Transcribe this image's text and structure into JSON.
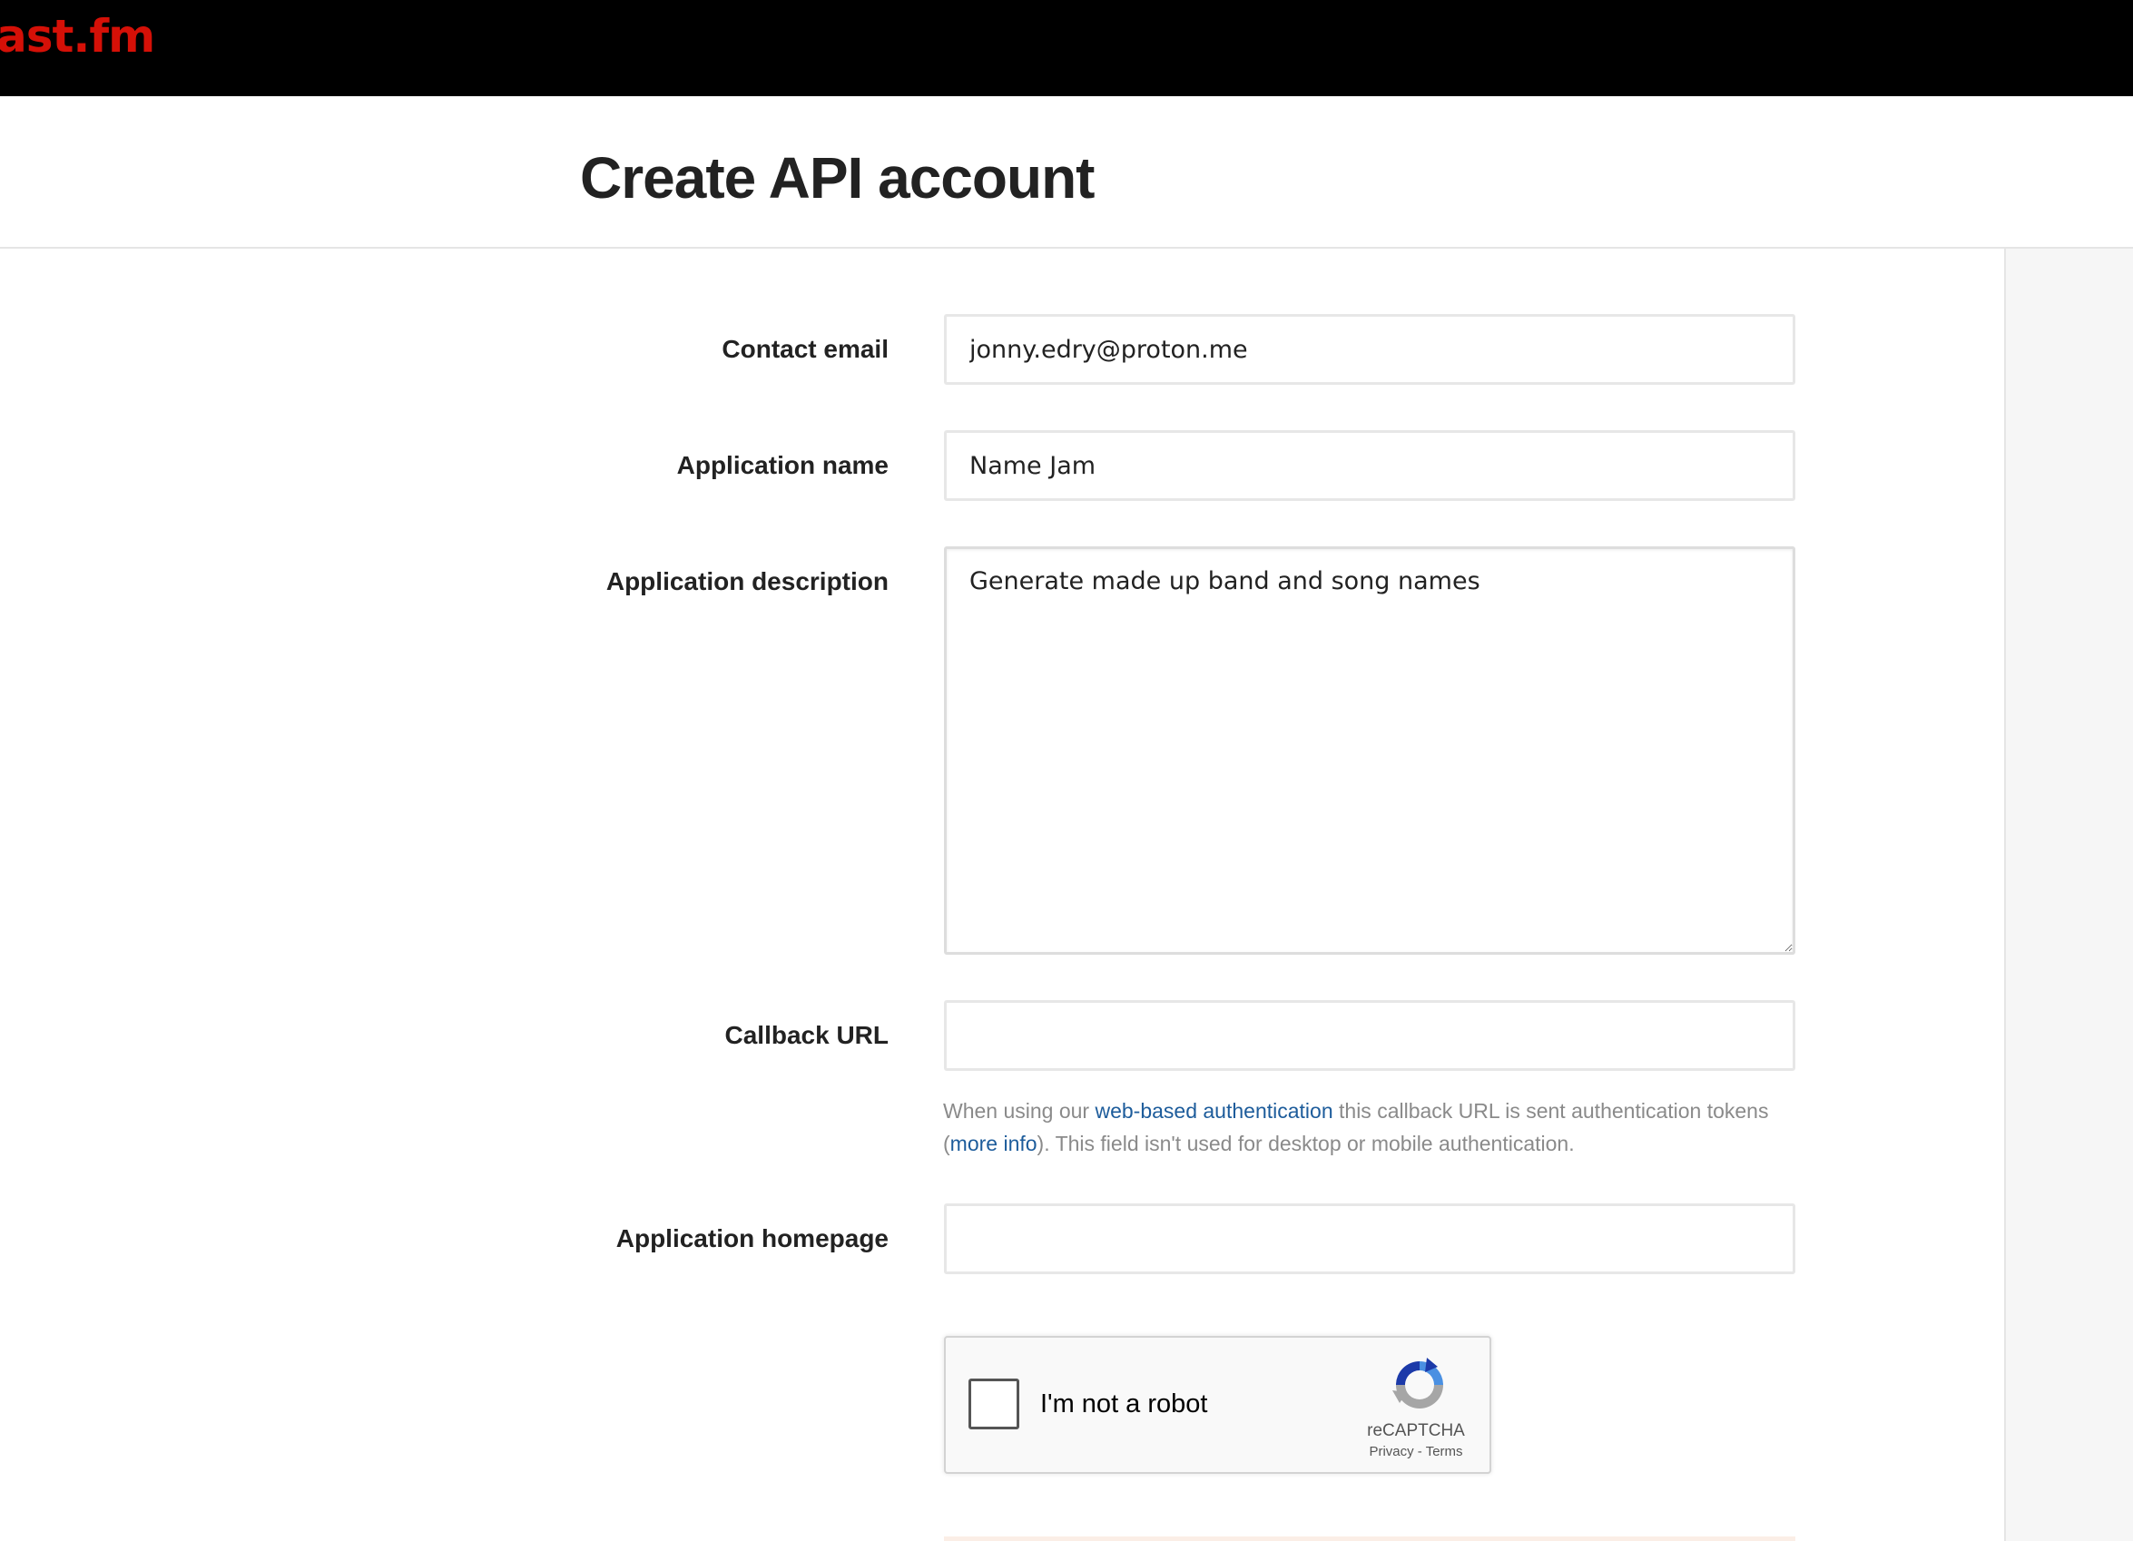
{
  "header": {
    "logo_text": "ast.fm",
    "brand_color": "#d51007"
  },
  "page": {
    "title": "Create API account"
  },
  "form": {
    "contact_email": {
      "label": "Contact email",
      "value": "jonny.edry@proton.me"
    },
    "application_name": {
      "label": "Application name",
      "value": "Name Jam"
    },
    "application_description": {
      "label": "Application description",
      "value": "Generate made up band and song names"
    },
    "callback_url": {
      "label": "Callback URL",
      "value": "",
      "help_prefix": "When using our ",
      "help_link": "web-based authentication",
      "help_middle": " this callback URL is sent authentication tokens (",
      "help_more_link": "more info",
      "help_suffix": "). This field isn't used for desktop or mobile authentication."
    },
    "application_homepage": {
      "label": "Application homepage",
      "value": ""
    }
  },
  "recaptcha": {
    "label": "I'm not a robot",
    "brand": "reCAPTCHA",
    "privacy": "Privacy",
    "separator": " - ",
    "terms": "Terms",
    "checked": false,
    "icon": "recaptcha-logo-icon"
  },
  "colors": {
    "link": "#1d5c9b",
    "help_text": "#8a8a8a"
  }
}
